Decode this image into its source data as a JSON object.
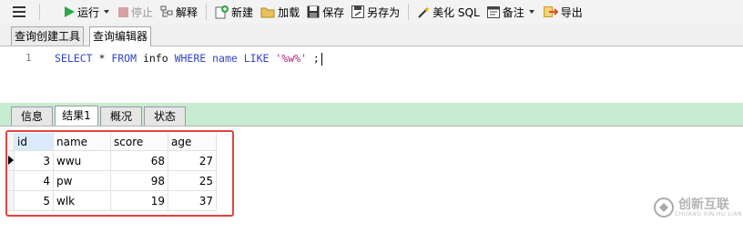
{
  "toolbar": {
    "menu_icon": "hamburger-menu-icon",
    "run_label": "运行",
    "stop_label": "停止",
    "explain_label": "解释",
    "new_label": "新建",
    "load_label": "加载",
    "save_label": "保存",
    "save_as_label": "另存为",
    "beautify_label": "美化 SQL",
    "comment_label": "备注",
    "export_label": "导出"
  },
  "query_tabs": [
    {
      "label": "查询创建工具"
    },
    {
      "label": "查询编辑器",
      "active": true
    }
  ],
  "editor": {
    "line_number": "1",
    "sql": {
      "select": "SELECT",
      "star": " * ",
      "from": "FROM",
      "table": " info ",
      "where": "WHERE",
      "col": " name ",
      "like": "LIKE",
      "pattern": " '%w%' ",
      "semi": ";"
    }
  },
  "result_tabs": [
    {
      "label": "信息"
    },
    {
      "label": "结果1",
      "active": true
    },
    {
      "label": "概况"
    },
    {
      "label": "状态"
    }
  ],
  "results": {
    "columns": [
      "id",
      "name",
      "score",
      "age"
    ],
    "rows": [
      {
        "id": "3",
        "name": "wwu",
        "score": "68",
        "age": "27"
      },
      {
        "id": "4",
        "name": "pw",
        "score": "98",
        "age": "25"
      },
      {
        "id": "5",
        "name": "wlk",
        "score": "19",
        "age": "37"
      }
    ]
  },
  "watermark": {
    "text": "创新互联",
    "sub": "CHUANG XIN HU LIAN"
  },
  "colors": {
    "highlight_border": "#e4433f",
    "run_green": "#2ea84a",
    "result_tab_band": "#c8ecd1"
  }
}
